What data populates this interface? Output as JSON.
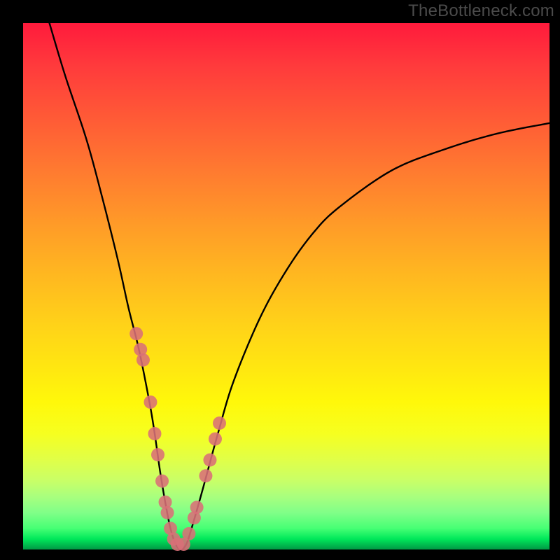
{
  "watermark": "TheBottleneck.com",
  "chart_data": {
    "type": "line",
    "title": "",
    "xlabel": "",
    "ylabel": "",
    "xlim": [
      0,
      100
    ],
    "ylim": [
      0,
      100
    ],
    "series": [
      {
        "name": "bottleneck-curve",
        "x": [
          5,
          8,
          12,
          15,
          18,
          20,
          22,
          24,
          25,
          26,
          27,
          28,
          29,
          30,
          31,
          32,
          34,
          37,
          40,
          45,
          50,
          55,
          60,
          70,
          80,
          90,
          100
        ],
        "values": [
          100,
          90,
          78,
          67,
          55,
          46,
          38,
          28,
          22,
          15,
          9,
          4,
          1,
          0,
          1,
          4,
          11,
          22,
          32,
          44,
          53,
          60,
          65,
          72,
          76,
          79,
          81
        ]
      },
      {
        "name": "highlight-points-left",
        "x": [
          21.5,
          22.3,
          22.8,
          24.2,
          25.0,
          25.6,
          26.4,
          27.0,
          27.4,
          28.0,
          28.6,
          29.3
        ],
        "values": [
          41,
          38,
          36,
          28,
          22,
          18,
          13,
          9,
          7,
          4,
          2,
          1
        ]
      },
      {
        "name": "highlight-points-right",
        "x": [
          30.5,
          31.5,
          32.5,
          33.0,
          34.7,
          35.5,
          36.5,
          37.3
        ],
        "values": [
          1,
          3,
          6,
          8,
          14,
          17,
          21,
          24
        ]
      }
    ],
    "point_color": "#d97078",
    "curve_color": "#000000"
  }
}
